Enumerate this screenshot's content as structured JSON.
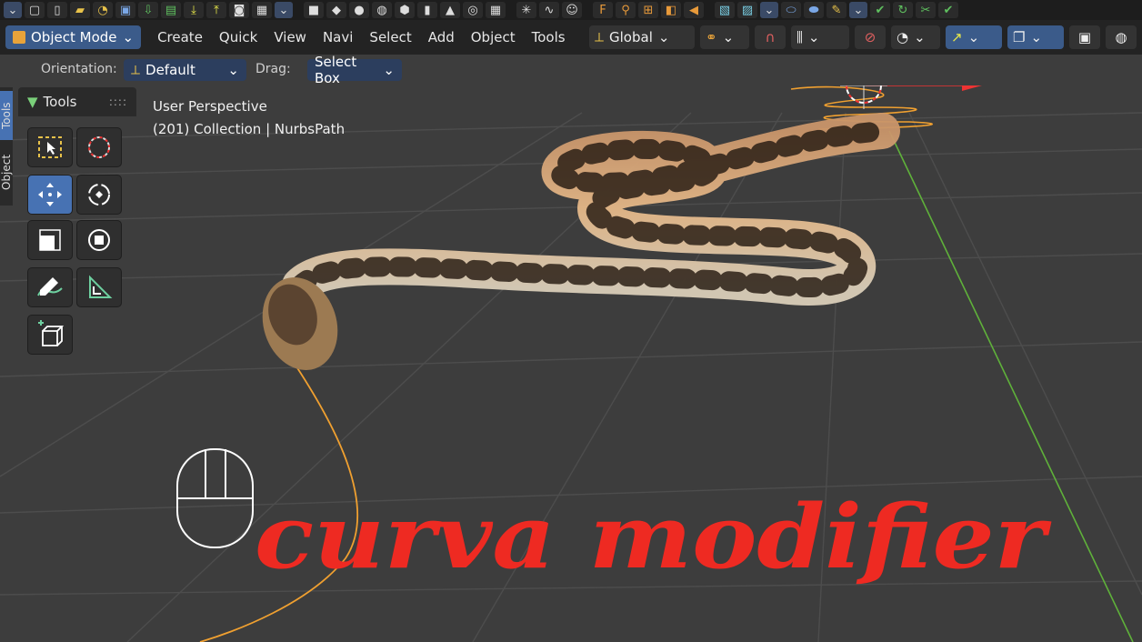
{
  "header": {
    "mode": "Object Mode",
    "menus": [
      "Create",
      "Quick",
      "View",
      "Navi",
      "Select",
      "Add",
      "Object",
      "Tools"
    ],
    "transform_orientation": "Global"
  },
  "tool_settings": {
    "orientation_label": "Orientation:",
    "orientation_value": "Default",
    "drag_label": "Drag:",
    "drag_value": "Select Box"
  },
  "side_tabs": [
    "Tools",
    "Object"
  ],
  "tools_panel": {
    "title": "Tools",
    "tools": [
      "select-box",
      "cursor",
      "move",
      "rotate",
      "scale",
      "transform",
      "annotate",
      "measure",
      "add-cube"
    ]
  },
  "viewport": {
    "perspective_label": "User Perspective",
    "collection_label": "(201) Collection | NurbsPath",
    "overlay_caption": "curva modifier"
  },
  "colors": {
    "accent": "#4772b3",
    "grid_bg": "#3d3d3d",
    "path": "#f0a030",
    "caption": "#ee2a22",
    "y_axis": "#5fb13a"
  }
}
